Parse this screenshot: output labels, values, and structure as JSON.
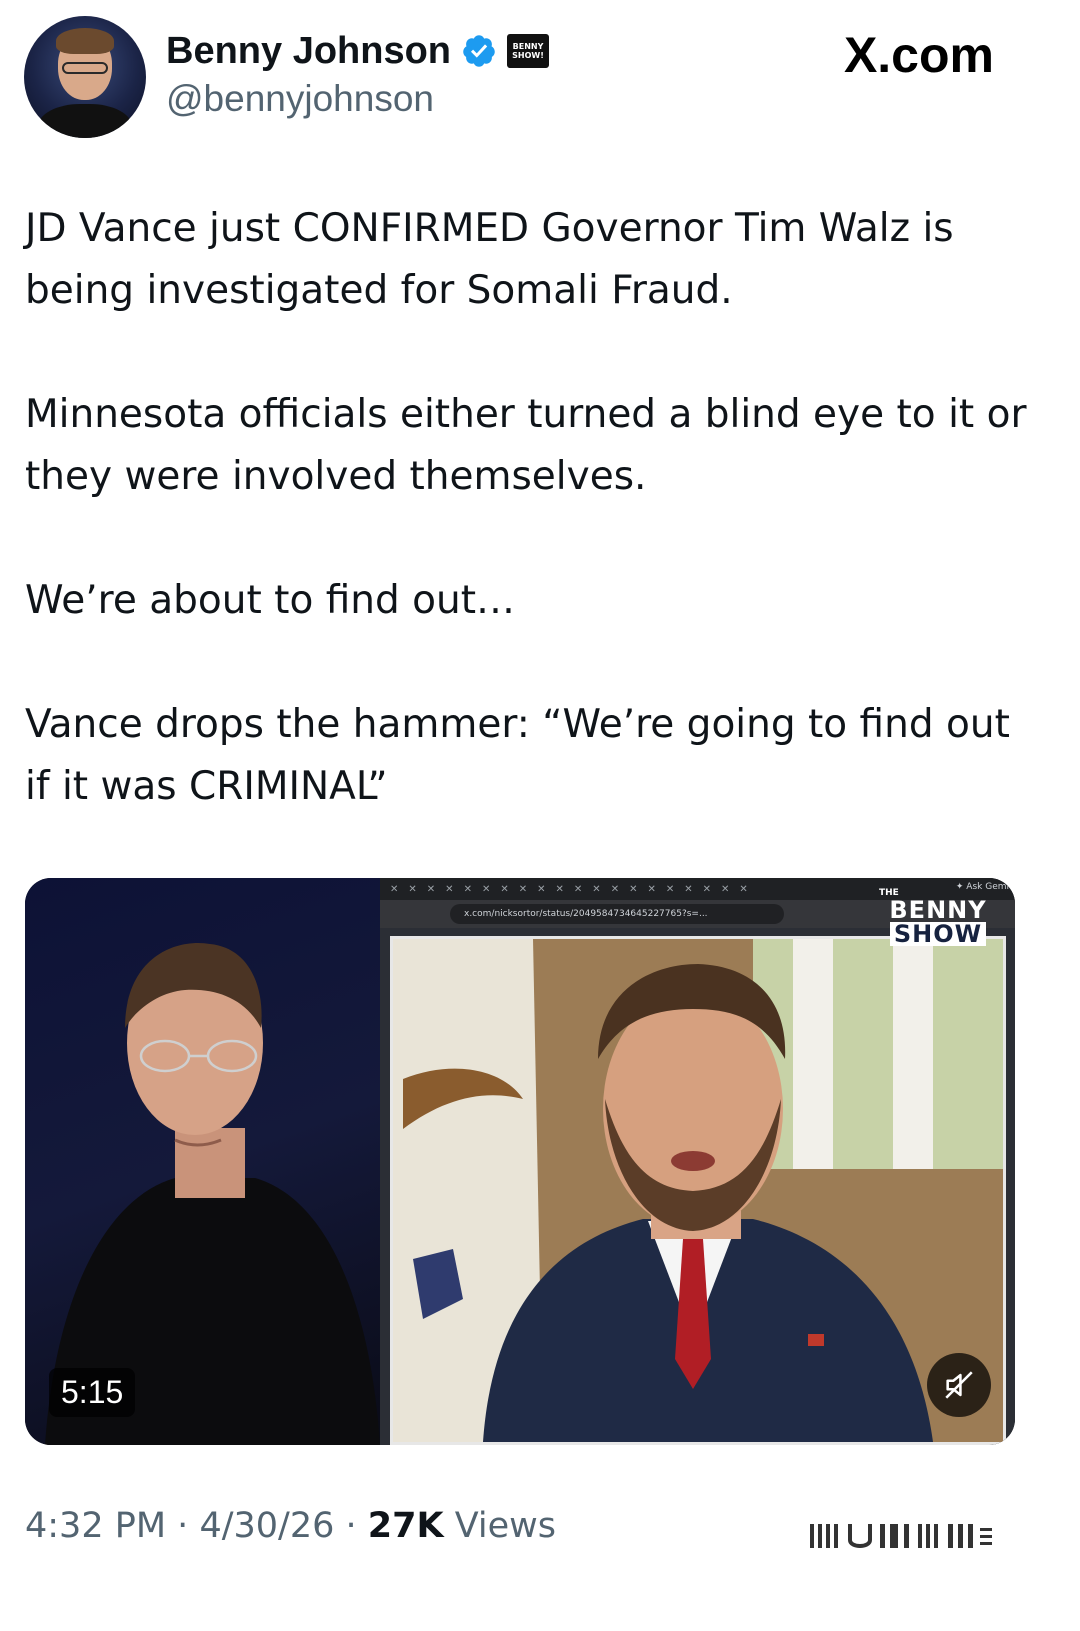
{
  "author": {
    "name": "Benny Johnson",
    "handle": "@bennyjohnson",
    "badge_text": "BENNY SHOW!"
  },
  "site_label": "X.com",
  "tweet": {
    "paragraphs": [
      "JD Vance just CONFIRMED Governor Tim Walz is being investigated for Somali Fraud.",
      "Minnesota officials either turned a blind eye to it or they were involved themselves.",
      "We’re about to find out…",
      "Vance drops the hammer: “We’re going to find out if it was CRIMINAL”"
    ]
  },
  "media": {
    "duration": "5:15",
    "browser": {
      "url": "x.com/nicksortor/status/2049584734645227765?s=...",
      "ask_label": "Ask Gemi"
    },
    "logo": {
      "the": "THE",
      "benny": "BENNY",
      "show": "SHOW"
    }
  },
  "footer": {
    "time": "4:32 PM",
    "date": "4/30/26",
    "views_count": "27K",
    "views_label": "Views"
  },
  "colors": {
    "verified": "#1d9bf0",
    "secondary_text": "#536471",
    "primary_text": "#0f1419"
  },
  "icons": [
    "verified-icon",
    "mute-icon"
  ]
}
